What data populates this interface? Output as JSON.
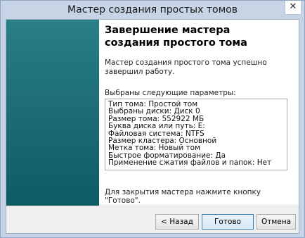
{
  "window": {
    "title": "Мастер создания простых томов",
    "close_glyph": "✕"
  },
  "content": {
    "heading": "Завершение мастера создания простого тома",
    "intro": "Мастер создания простого тома успешно завершил работу.",
    "params_label": "Выбраны следующие параметры:",
    "params": [
      "Тип тома: Простой том",
      "Выбраны диски: Диск 0",
      "Размер тома: 552922 МБ",
      "Буква диска или путь: E:",
      "Файловая система: NTFS",
      "Размер кластера: Основной",
      "Метка тома: Новый том",
      "Быстрое форматирование: Да",
      "Применение сжатия файлов и папок: Нет"
    ],
    "footer": "Для закрытия мастера нажмите кнопку \"Готово\"."
  },
  "buttons": {
    "back": "< Назад",
    "finish": "Готово",
    "cancel": "Отмена"
  },
  "colors": {
    "side_panel": "#1a6b72",
    "title_bar": "#c6d4e6"
  }
}
